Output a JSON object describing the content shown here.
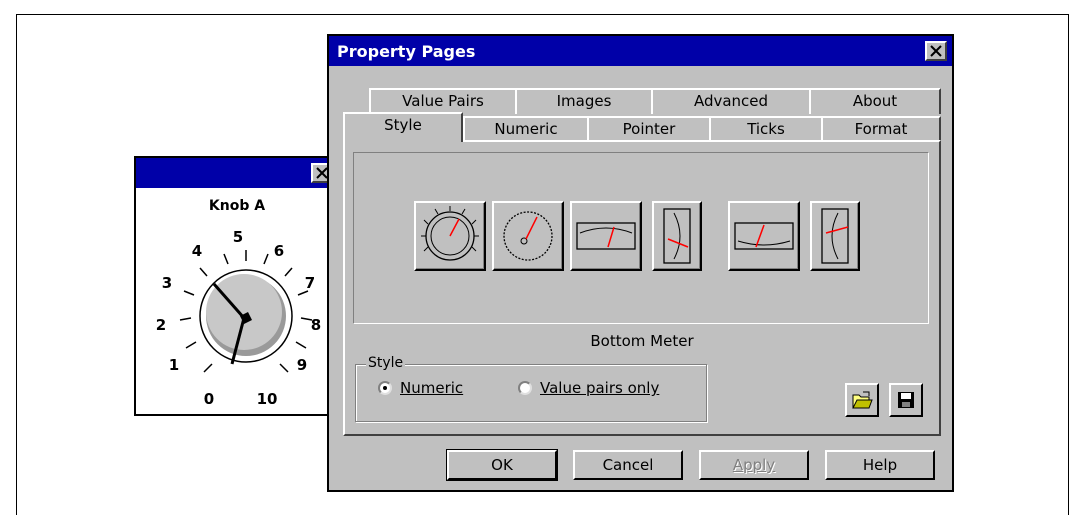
{
  "knob_window": {
    "label": "Knob A",
    "scale_labels": [
      "0",
      "1",
      "2",
      "3",
      "4",
      "5",
      "6",
      "7",
      "8",
      "9",
      "10"
    ]
  },
  "dialog": {
    "title": "Property Pages",
    "tabs_back": [
      "Value Pairs",
      "Images",
      "Advanced",
      "About"
    ],
    "tabs_front": [
      "Style",
      "Numeric",
      "Pointer",
      "Ticks",
      "Format"
    ],
    "active_tab": "Style",
    "meter_styles": [
      "knob",
      "dial",
      "top-meter",
      "right-meter",
      "bottom-meter",
      "left-meter"
    ],
    "selected_caption": "Bottom Meter",
    "style_group": {
      "legend": "Style",
      "option_numeric": "Numeric",
      "option_value_pairs": "Value pairs only",
      "selected": "Numeric"
    },
    "icons": [
      "open-folder-icon",
      "save-disk-icon"
    ],
    "buttons": {
      "ok": "OK",
      "cancel": "Cancel",
      "apply": "Apply",
      "help": "Help"
    }
  },
  "colors": {
    "title_bar": "#0000a8",
    "face": "#c0c0c0",
    "needle": "#ff0000"
  }
}
